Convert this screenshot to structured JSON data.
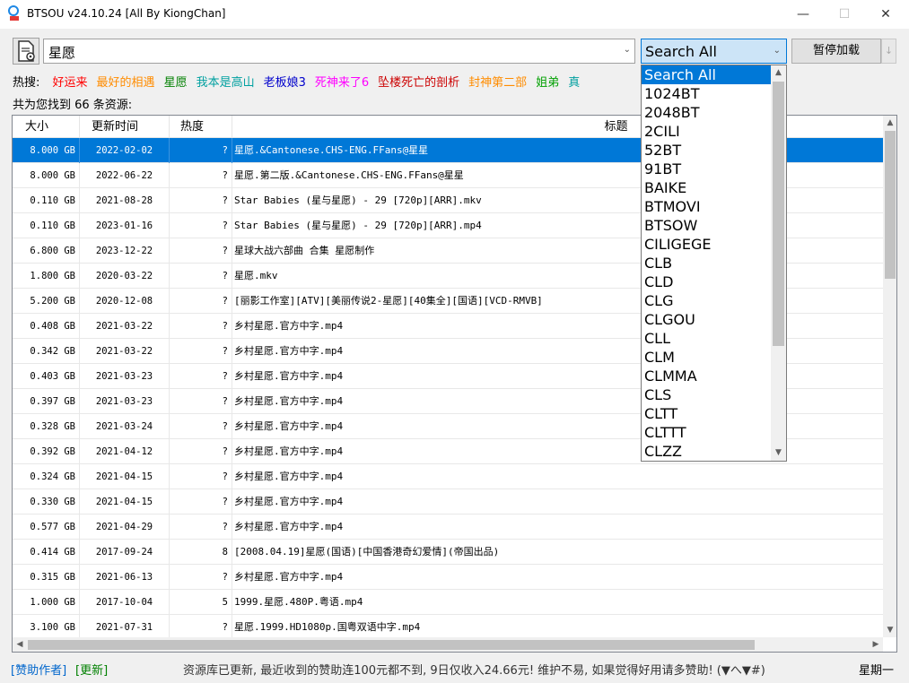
{
  "window": {
    "title": "BTSOU v24.10.24 [All By KiongChan]",
    "minimize": "—",
    "maximize": "☐",
    "close": "✕"
  },
  "search": {
    "query": "星愿",
    "engine": "Search All",
    "pause_label": "暂停加载",
    "split_arrow": "↓"
  },
  "hot": {
    "label": "热搜:",
    "items": [
      {
        "text": "好运来",
        "color": "#ff0000"
      },
      {
        "text": "最好的相遇",
        "color": "#ff8c00"
      },
      {
        "text": "星愿",
        "color": "#008000"
      },
      {
        "text": "我本是高山",
        "color": "#00a0a0"
      },
      {
        "text": "老板娘3",
        "color": "#0000cc"
      },
      {
        "text": "死神来了6",
        "color": "#ff00ff"
      },
      {
        "text": "坠楼死亡的剖析",
        "color": "#cc0000"
      },
      {
        "text": "封神第二部",
        "color": "#ff8c00"
      },
      {
        "text": "姐弟",
        "color": "#00a000"
      },
      {
        "text": "真",
        "color": "#00a0a0"
      }
    ]
  },
  "result_summary": "共为您找到 66 条资源:",
  "table": {
    "headers": {
      "size": "大小",
      "date": "更新时间",
      "heat": "热度",
      "title": "标题"
    },
    "rows": [
      {
        "size": "8.000 GB",
        "date": "2022-02-02",
        "heat": "?",
        "title": "星愿.&Cantonese.CHS-ENG.FFans@星星"
      },
      {
        "size": "8.000 GB",
        "date": "2022-06-22",
        "heat": "?",
        "title": "星愿.第二版.&Cantonese.CHS-ENG.FFans@星星"
      },
      {
        "size": "0.110 GB",
        "date": "2021-08-28",
        "heat": "?",
        "title": "Star Babies (星与星愿) - 29 [720p][ARR].mkv"
      },
      {
        "size": "0.110 GB",
        "date": "2023-01-16",
        "heat": "?",
        "title": "Star Babies (星与星愿) - 29 [720p][ARR].mp4"
      },
      {
        "size": "6.800 GB",
        "date": "2023-12-22",
        "heat": "?",
        "title": "星球大战六部曲 合集  星愿制作"
      },
      {
        "size": "1.800 GB",
        "date": "2020-03-22",
        "heat": "?",
        "title": "星愿.mkv"
      },
      {
        "size": "5.200 GB",
        "date": "2020-12-08",
        "heat": "?",
        "title": "[丽影工作室][ATV][美丽传说2-星愿][40集全][国语][VCD-RMVB]"
      },
      {
        "size": "0.408 GB",
        "date": "2021-03-22",
        "heat": "?",
        "title": "乡村星愿.官方中字.mp4"
      },
      {
        "size": "0.342 GB",
        "date": "2021-03-22",
        "heat": "?",
        "title": "乡村星愿.官方中字.mp4"
      },
      {
        "size": "0.403 GB",
        "date": "2021-03-23",
        "heat": "?",
        "title": "乡村星愿.官方中字.mp4"
      },
      {
        "size": "0.397 GB",
        "date": "2021-03-23",
        "heat": "?",
        "title": "乡村星愿.官方中字.mp4"
      },
      {
        "size": "0.328 GB",
        "date": "2021-03-24",
        "heat": "?",
        "title": "乡村星愿.官方中字.mp4"
      },
      {
        "size": "0.392 GB",
        "date": "2021-04-12",
        "heat": "?",
        "title": "乡村星愿.官方中字.mp4"
      },
      {
        "size": "0.324 GB",
        "date": "2021-04-15",
        "heat": "?",
        "title": "乡村星愿.官方中字.mp4"
      },
      {
        "size": "0.330 GB",
        "date": "2021-04-15",
        "heat": "?",
        "title": "乡村星愿.官方中字.mp4"
      },
      {
        "size": "0.577 GB",
        "date": "2021-04-29",
        "heat": "?",
        "title": "乡村星愿.官方中字.mp4"
      },
      {
        "size": "0.414 GB",
        "date": "2017-09-24",
        "heat": "8",
        "title": "[2008.04.19]星愿(国语)[中国香港奇幻爱情](帝国出品)"
      },
      {
        "size": "0.315 GB",
        "date": "2021-06-13",
        "heat": "?",
        "title": "乡村星愿.官方中字.mp4"
      },
      {
        "size": "1.000 GB",
        "date": "2017-10-04",
        "heat": "5",
        "title": "1999.星愿.480P.粤语.mp4"
      },
      {
        "size": "3.100 GB",
        "date": "2021-07-31",
        "heat": "?",
        "title": "星愿.1999.HD1080p.国粤双语中字.mp4"
      }
    ],
    "selected_index": 0
  },
  "engine_options": [
    "Search All",
    "1024BT",
    "2048BT",
    "2CILI",
    "52BT",
    "91BT",
    "BAIKE",
    "BTMOVI",
    "BTSOW",
    "CILIGEGE",
    "CLB",
    "CLD",
    "CLG",
    "CLGOU",
    "CLL",
    "CLM",
    "CLMMA",
    "CLS",
    "CLTT",
    "CLTTT",
    "CLZZ"
  ],
  "status": {
    "sponsor": "[赞助作者]",
    "update": "[更新]",
    "message": "资源库已更新, 最近收到的赞助连100元都不到, 9日仅收入24.66元! 维护不易, 如果觉得好用请多赞助! (▼へ▼#)",
    "weekday": "星期一"
  },
  "colors": {
    "selection": "#0078d7",
    "engine_select_bg": "#cce4f7"
  }
}
